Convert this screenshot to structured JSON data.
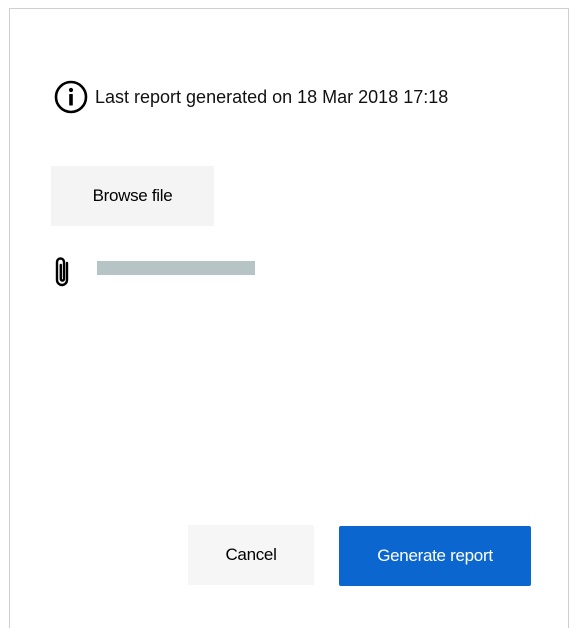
{
  "info": {
    "icon": "info-icon",
    "text": "Last report generated on 18 Mar 2018 17:18"
  },
  "browse": {
    "label": "Browse file"
  },
  "attachment": {
    "icon": "paperclip-icon",
    "filename": ""
  },
  "footer": {
    "cancel_label": "Cancel",
    "generate_label": "Generate report"
  },
  "colors": {
    "primary": "#0b66d0",
    "secondary_button_bg": "#f4f4f4",
    "placeholder_bar": "#b7c4c6"
  }
}
